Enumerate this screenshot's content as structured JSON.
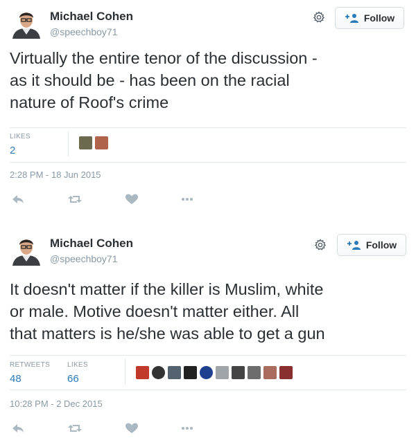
{
  "tweets": [
    {
      "author": {
        "name": "Michael Cohen",
        "handle": "@speechboy71"
      },
      "follow_label": "Follow",
      "text_lines": [
        "Virtually the entire tenor of the discussion -",
        "as it should be - has been on the racial",
        "nature of Roof's crime"
      ],
      "stats": [
        {
          "label": "LIKES",
          "value": "2"
        }
      ],
      "liker_colors": [
        "#6b6a4e",
        "#b0634b"
      ],
      "timestamp": "2:28 PM - 18 Jun 2015",
      "actions": [
        "reply-icon",
        "retweet-icon",
        "like-icon",
        "more-icon"
      ]
    },
    {
      "author": {
        "name": "Michael Cohen",
        "handle": "@speechboy71"
      },
      "follow_label": "Follow",
      "text_lines": [
        "It doesn't matter if the killer is Muslim, white",
        "or male. Motive doesn't matter either. All",
        "that matters is he/she was able to get a gun"
      ],
      "stats": [
        {
          "label": "RETWEETS",
          "value": "48"
        },
        {
          "label": "LIKES",
          "value": "66"
        }
      ],
      "liker_colors": [
        "#c0392b",
        "#333333",
        "#556270",
        "#222222",
        "#1f3f8f",
        "#9fa5a8",
        "#444444",
        "#6d6d6d",
        "#a86d5c",
        "#8a2f2f"
      ],
      "timestamp": "10:28 PM - 2 Dec 2015",
      "actions": [
        "reply-icon",
        "retweet-icon",
        "like-icon",
        "more-icon"
      ]
    }
  ],
  "colors": {
    "link": "#2b7bb9",
    "muted": "#8899a6",
    "text": "#292f33",
    "border": "#e1e8ed"
  }
}
